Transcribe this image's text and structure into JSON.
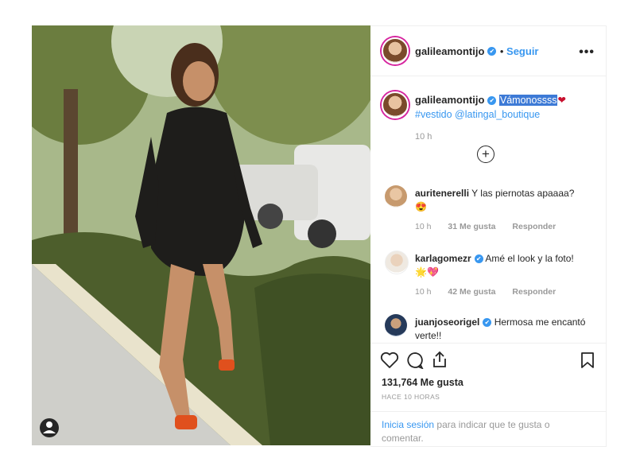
{
  "post_author": {
    "username": "galileamontijo",
    "follow_label": "Seguir",
    "more_icon": "more-dots-icon"
  },
  "caption": {
    "username": "galileamontijo",
    "highlighted": "Vámonossss",
    "emoji": "❤",
    "hashtag": "#vestido",
    "mention": "@latingal_boutique",
    "time": "10 h"
  },
  "comments": [
    {
      "username": "auritenerelli",
      "verified": false,
      "text": "Y las piernotas apaaaa?",
      "emoji": "😍",
      "time": "10 h",
      "likes": "31 Me gusta",
      "reply": "Responder"
    },
    {
      "username": "karlagomezr",
      "verified": true,
      "text": "Amé el look y la foto!",
      "emoji": "🌟💖",
      "time": "10 h",
      "likes": "42 Me gusta",
      "reply": "Responder"
    },
    {
      "username": "juanjoseorigel",
      "verified": true,
      "text": "Hermosa me encantó verte!!"
    }
  ],
  "likes": "131,764 Me gusta",
  "posted_ago": "HACE 10 HORAS",
  "login_prompt": {
    "link": "Inicia sesión",
    "text": "para indicar que te gusta o comentar."
  }
}
